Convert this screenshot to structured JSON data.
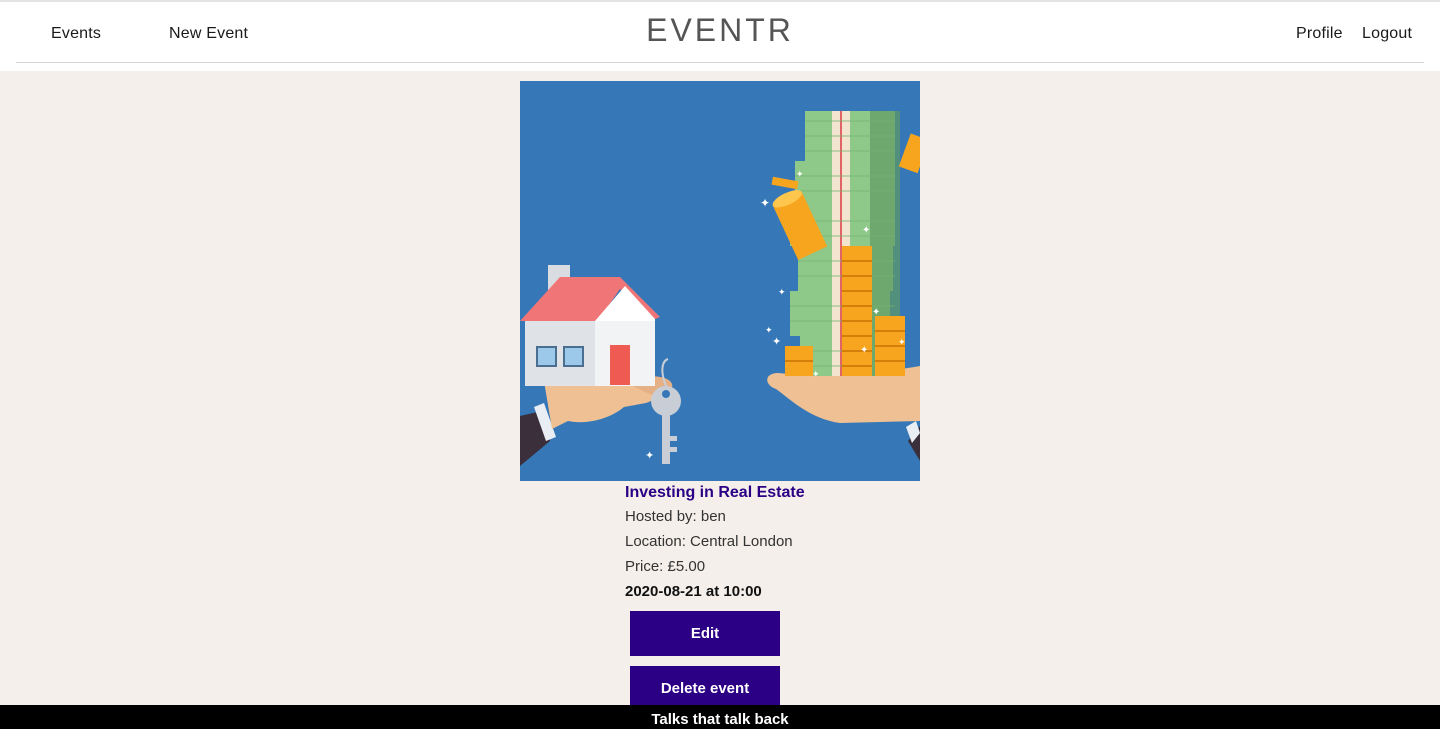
{
  "header": {
    "logo": "EVENTR",
    "nav_left": [
      {
        "label": "Events"
      },
      {
        "label": "New Event"
      }
    ],
    "nav_right": [
      {
        "label": "Profile"
      },
      {
        "label": "Logout"
      }
    ]
  },
  "event": {
    "image_icon": "house-key-and-money-illustration",
    "title": "Investing in Real Estate",
    "hosted_by": "Hosted by: ben",
    "location": "Location: Central London",
    "price": "Price: £5.00",
    "datetime": "2020-08-21 at 10:00",
    "edit_label": "Edit",
    "delete_label": "Delete event"
  },
  "footer": {
    "tagline": "Talks that talk back"
  },
  "colors": {
    "accent": "#2b0085",
    "background": "#f4efeb",
    "image_bg": "#3577b7"
  }
}
